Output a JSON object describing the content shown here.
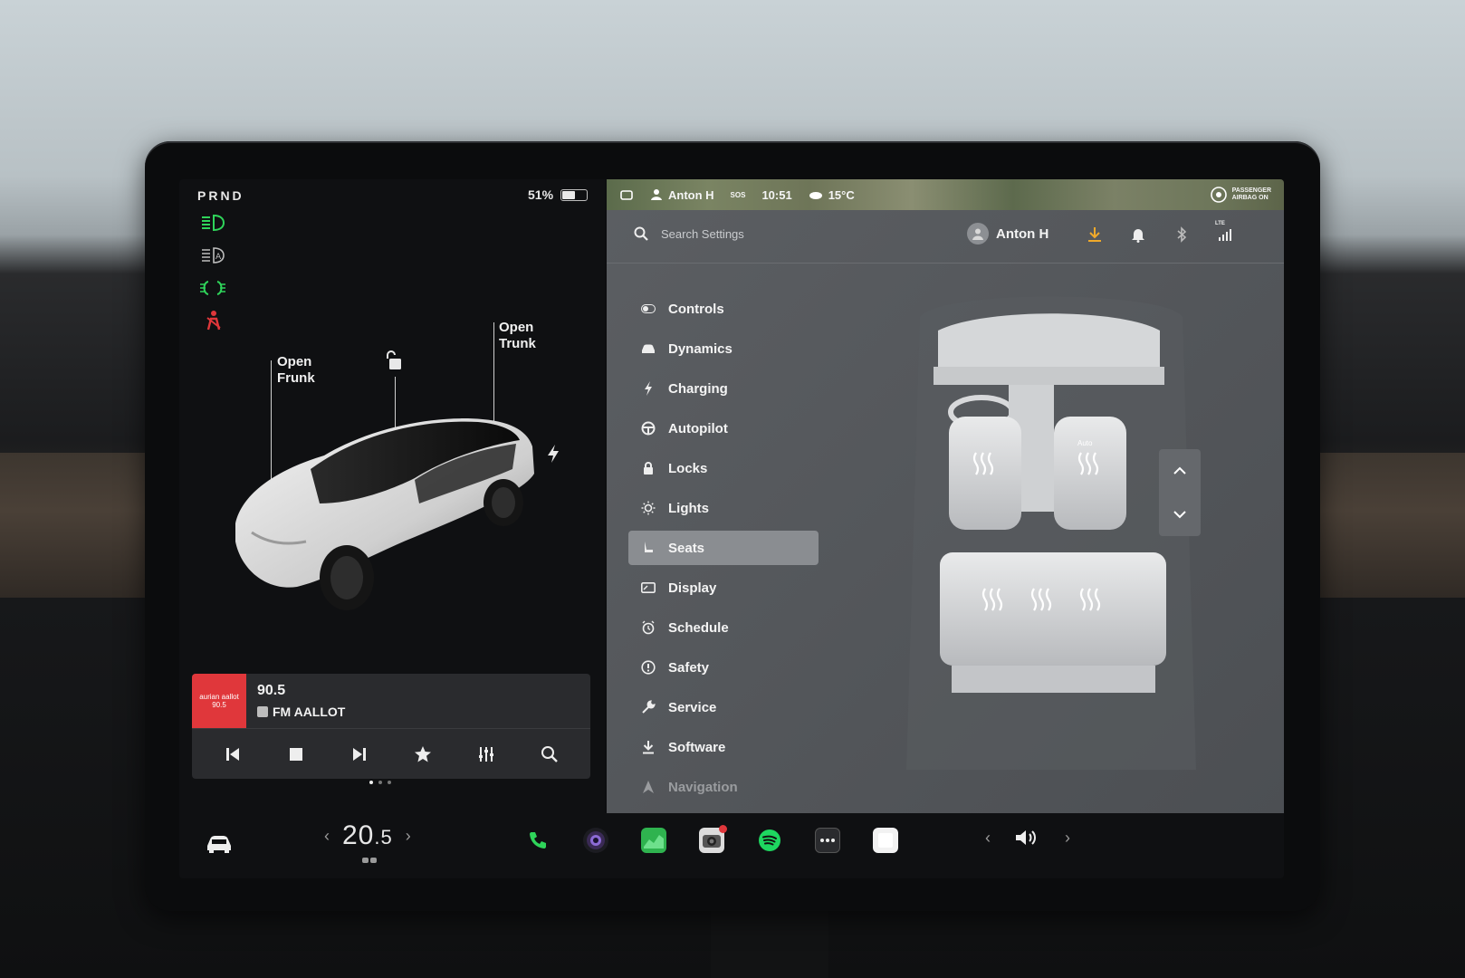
{
  "status": {
    "gear": "PRND",
    "battery_pct": "51%",
    "battery_level": 0.51
  },
  "car_panel": {
    "frunk_label_line1": "Open",
    "frunk_label_line2": "Frunk",
    "trunk_label_line1": "Open",
    "trunk_label_line2": "Trunk"
  },
  "media": {
    "art_text": "aurian aallot 90.5",
    "frequency": "90.5",
    "station": "FM AALLOT"
  },
  "map_strip": {
    "user": "Anton H",
    "sos": "SOS",
    "time": "10:51",
    "temp": "15°C",
    "airbag_line1": "PASSENGER",
    "airbag_line2": "AIRBAG ON"
  },
  "settings": {
    "search_placeholder": "Search Settings",
    "user_name": "Anton H",
    "lte": "LTE",
    "menu": [
      {
        "label": "Controls",
        "icon": "toggle-icon"
      },
      {
        "label": "Dynamics",
        "icon": "car-front-icon"
      },
      {
        "label": "Charging",
        "icon": "bolt-icon"
      },
      {
        "label": "Autopilot",
        "icon": "steering-wheel-icon"
      },
      {
        "label": "Locks",
        "icon": "lock-icon"
      },
      {
        "label": "Lights",
        "icon": "sun-icon"
      },
      {
        "label": "Seats",
        "icon": "seat-icon"
      },
      {
        "label": "Display",
        "icon": "display-icon"
      },
      {
        "label": "Schedule",
        "icon": "alarm-icon"
      },
      {
        "label": "Safety",
        "icon": "info-icon"
      },
      {
        "label": "Service",
        "icon": "wrench-icon"
      },
      {
        "label": "Software",
        "icon": "download-icon"
      },
      {
        "label": "Navigation",
        "icon": "navigation-icon"
      }
    ],
    "active_item": "Seats",
    "seat_heater_auto": "Auto"
  },
  "bottom_bar": {
    "temperature_int": "20",
    "temperature_dec": ".5"
  },
  "colors": {
    "accent_green": "#2fd45a",
    "warning_red": "#e0373b",
    "download_amber": "#f0a92a",
    "spotify_green": "#1ed760"
  }
}
